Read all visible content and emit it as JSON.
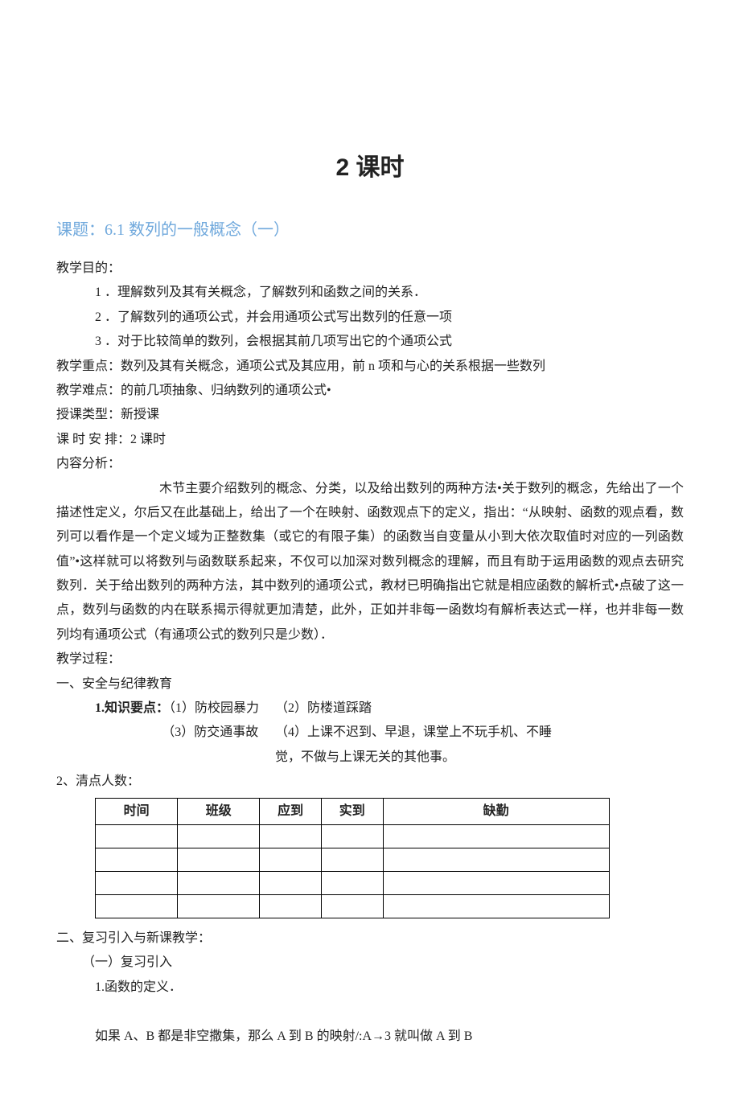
{
  "title_main": "2 课时",
  "topic": {
    "label": "课题：",
    "body": "6.1 数列的一般概念（一）"
  },
  "goals_label": "教学目的：",
  "goals": [
    "1 ．理解数列及其有关概念，了解数列和函数之间的关系．",
    "2 ．了解数列的通项公式，并会用通项公式写出数列的任意一项",
    "3 ．对于比较简单的数列，会根据其前几项写出它的个通项公式"
  ],
  "focus": {
    "label": "教学重点：",
    "text": "数列及其有关概念，通项公式及其应用，前 n 项和与心的关系根据一些数列"
  },
  "difficulty": {
    "label": "教学难点：",
    "text": "的前几项抽象、归纳数列的通项公式•"
  },
  "ctype": {
    "label": "授课类型：",
    "text": "新授课"
  },
  "hours": {
    "label": "课 时 安 排：",
    "text": "2 课时"
  },
  "analysis_label": "内容分析：",
  "analysis_body": "木节主要介绍数列的概念、分类，以及给出数列的两种方法•关于数列的概念，先给出了一个描述性定义，尔后又在此基础上，给出了一个在映射、函数观点下的定义，指出：“从映射、函数的观点看，数列可以看作是一个定义域为正整数集（或它的有限子集）的函数当自变量从小到大依次取值时对应的一列函数值”•这样就可以将数列与函数联系起来，不仅可以加深对数列概念的理解，而且有助于运用函数的观点去研究数列．关于给出数列的两种方法，其中数列的通项公式，教材已明确指出它就是相应函数的解析式•点破了这一点，数列与函数的内在联系揭示得就更加清楚，此外，正如并非每一函数均有解析表达式一样，也并非每一数列均有通项公式（有通项公式的数列只是少数）．",
  "process_label": "教学过程：",
  "sec_a": "一、安全与纪律教育",
  "kp_label": "1.知识要点：",
  "kp": {
    "a": "（1）防校园暴力",
    "b": "（2）防楼道踩踏",
    "c": "（3）防交通事故",
    "d": "（4）上课不迟到、早退，课堂上不玩手机、不睡",
    "d_tail": "觉，不做与上课无关的其他事。"
  },
  "attendance_label": "2、清点人数：",
  "attendance_headers": [
    "时间",
    "班级",
    "应到",
    "实到",
    "缺勤"
  ],
  "sec_b": "二、复习引入与新课教学：",
  "review_head": "（一）复习引入",
  "review_item": "1.函数的定义．",
  "review_para": "如果 A、B 都是非空撒集，那么 A 到 B 的映射/:A→3 就叫做 A 到 B"
}
